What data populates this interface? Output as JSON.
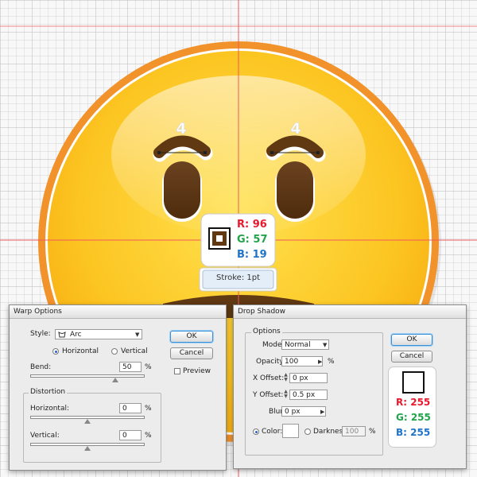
{
  "guides": {
    "marks": [
      "4",
      "4"
    ]
  },
  "color_sample": {
    "r": "R: 96",
    "g": "G: 57",
    "b": "B: 19",
    "swatch_color": "#603913",
    "stroke_label": "Stroke: 1pt"
  },
  "warp": {
    "title": "Warp Options",
    "style_label": "Style:",
    "style_value": "Arc",
    "horizontal_label": "Horizontal",
    "vertical_label": "Vertical",
    "orientation_selected": "horizontal",
    "bend_label": "Bend:",
    "bend_value": "50",
    "pct": "%",
    "distortion_label": "Distortion",
    "dist_horizontal_label": "Horizontal:",
    "dist_horizontal_value": "0",
    "dist_vertical_label": "Vertical:",
    "dist_vertical_value": "0",
    "ok": "OK",
    "cancel": "Cancel",
    "preview": "Preview"
  },
  "shadow": {
    "title": "Drop Shadow",
    "options_label": "Options",
    "mode_label": "Mode:",
    "mode_value": "Normal",
    "opacity_label": "Opacity:",
    "opacity_value": "100",
    "pct": "%",
    "x_offset_label": "X Offset:",
    "x_offset_value": "0 px",
    "y_offset_label": "Y Offset:",
    "y_offset_value": "0.5 px",
    "blur_label": "Blur:",
    "blur_value": "0 px",
    "color_label": "Color:",
    "darkness_label": "Darkness:",
    "darkness_value": "100",
    "ok": "OK",
    "cancel": "Cancel",
    "preview_r": "R: 255",
    "preview_g": "G: 255",
    "preview_b": "B: 255"
  },
  "colors": {
    "r": "#e8192c",
    "g": "#21a34a",
    "b": "#1f73c8",
    "face": "#fcc521",
    "rim": "#f1922a",
    "feature": "#603913"
  }
}
